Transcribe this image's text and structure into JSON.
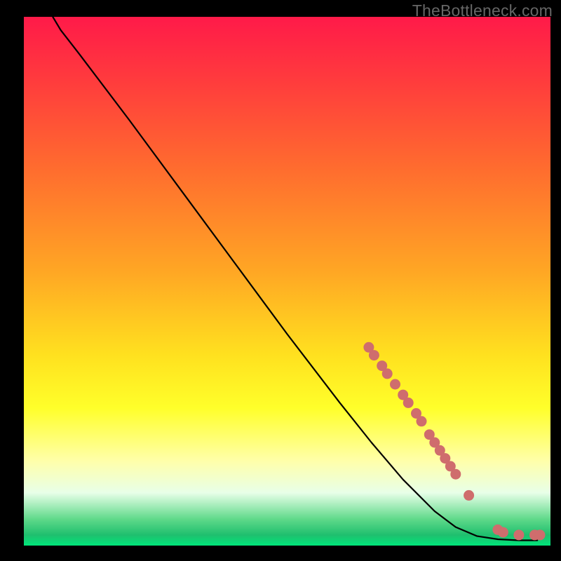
{
  "watermark": "TheBottleneck.com",
  "colors": {
    "dot_fill": "#cf6d6d",
    "dot_stroke": "#cf6d6d",
    "curve": "#000000"
  },
  "chart_data": {
    "type": "line",
    "title": "",
    "xlabel": "",
    "ylabel": "",
    "xlim": [
      0,
      100
    ],
    "ylim": [
      0,
      100
    ],
    "curve_points": [
      {
        "x": 5.5,
        "y": 100
      },
      {
        "x": 7,
        "y": 97.5
      },
      {
        "x": 10.5,
        "y": 93
      },
      {
        "x": 20,
        "y": 80.5
      },
      {
        "x": 30,
        "y": 67
      },
      {
        "x": 40,
        "y": 53.5
      },
      {
        "x": 50,
        "y": 40
      },
      {
        "x": 60,
        "y": 27
      },
      {
        "x": 66,
        "y": 19.5
      },
      {
        "x": 72,
        "y": 12.5
      },
      {
        "x": 78,
        "y": 6.5
      },
      {
        "x": 82,
        "y": 3.5
      },
      {
        "x": 86,
        "y": 1.8
      },
      {
        "x": 90,
        "y": 1.2
      },
      {
        "x": 94,
        "y": 1.0
      },
      {
        "x": 97.5,
        "y": 1.0
      }
    ],
    "dot_points": [
      {
        "x": 65.5,
        "y": 37.5
      },
      {
        "x": 66.5,
        "y": 36
      },
      {
        "x": 68,
        "y": 34
      },
      {
        "x": 69,
        "y": 32.5
      },
      {
        "x": 70.5,
        "y": 30.5
      },
      {
        "x": 72,
        "y": 28.5
      },
      {
        "x": 73,
        "y": 27
      },
      {
        "x": 74.5,
        "y": 25
      },
      {
        "x": 75.5,
        "y": 23.5
      },
      {
        "x": 77,
        "y": 21
      },
      {
        "x": 78,
        "y": 19.5
      },
      {
        "x": 79,
        "y": 18
      },
      {
        "x": 80,
        "y": 16.5
      },
      {
        "x": 81,
        "y": 15
      },
      {
        "x": 82,
        "y": 13.5
      },
      {
        "x": 84.5,
        "y": 9.5
      },
      {
        "x": 90,
        "y": 3
      },
      {
        "x": 91,
        "y": 2.5
      },
      {
        "x": 94,
        "y": 2
      },
      {
        "x": 97,
        "y": 2
      },
      {
        "x": 98,
        "y": 2
      }
    ],
    "dot_radius": 7
  }
}
